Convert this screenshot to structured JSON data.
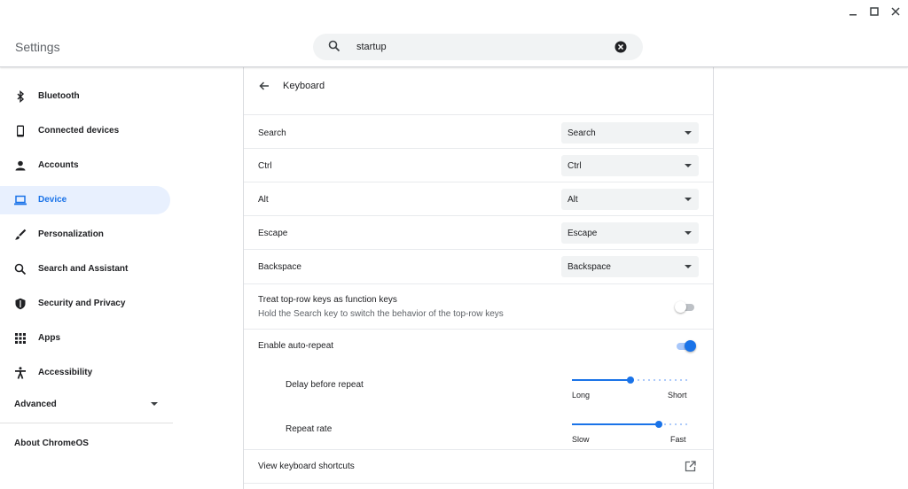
{
  "window": {
    "controls": [
      "minimize",
      "maximize",
      "close"
    ]
  },
  "header": {
    "title": "Settings"
  },
  "search": {
    "value": "startup"
  },
  "sidebar": {
    "items": [
      {
        "label": "Bluetooth",
        "icon": "bluetooth-icon",
        "active": false
      },
      {
        "label": "Connected devices",
        "icon": "phone-icon",
        "active": false
      },
      {
        "label": "Accounts",
        "icon": "person-icon",
        "active": false
      },
      {
        "label": "Device",
        "icon": "laptop-icon",
        "active": true
      },
      {
        "label": "Personalization",
        "icon": "brush-icon",
        "active": false
      },
      {
        "label": "Search and Assistant",
        "icon": "search-icon",
        "active": false
      },
      {
        "label": "Security and Privacy",
        "icon": "shield-icon",
        "active": false
      },
      {
        "label": "Apps",
        "icon": "apps-grid-icon",
        "active": false
      },
      {
        "label": "Accessibility",
        "icon": "accessibility-icon",
        "active": false
      }
    ],
    "advanced": "Advanced",
    "about": "About ChromeOS"
  },
  "colors": {
    "accent": "#1a73e8",
    "active_bg": "#e8f0fe",
    "select_bg": "#f1f3f4"
  },
  "main": {
    "title": "Keyboard",
    "remaps": [
      {
        "label": "Search",
        "value": "Search"
      },
      {
        "label": "Ctrl",
        "value": "Ctrl"
      },
      {
        "label": "Alt",
        "value": "Alt"
      },
      {
        "label": "Escape",
        "value": "Escape"
      },
      {
        "label": "Backspace",
        "value": "Backspace"
      }
    ],
    "function_keys": {
      "label": "Treat top-row keys as function keys",
      "sublabel": "Hold the Search key to switch the behavior of the top-row keys",
      "enabled": false
    },
    "auto_repeat": {
      "label": "Enable auto-repeat",
      "enabled": true
    },
    "delay": {
      "label": "Delay before repeat",
      "min_label": "Long",
      "max_label": "Short",
      "value_fraction": 0.5
    },
    "rate": {
      "label": "Repeat rate",
      "min_label": "Slow",
      "max_label": "Fast",
      "value_fraction": 0.75
    },
    "shortcuts": {
      "label": "View keyboard shortcuts"
    }
  }
}
